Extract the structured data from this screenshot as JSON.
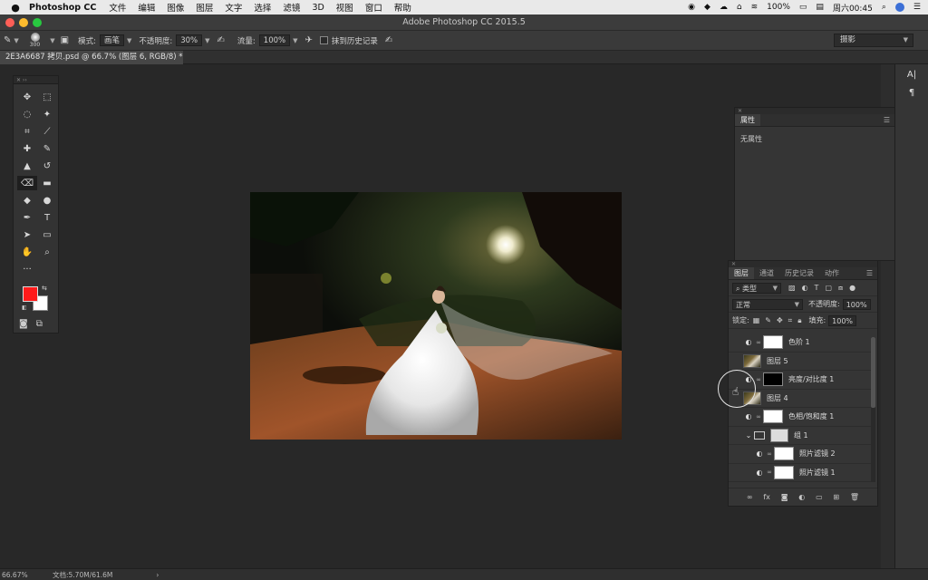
{
  "menubar": {
    "app_name": "Photoshop CC",
    "items": [
      "文件",
      "编辑",
      "图像",
      "图层",
      "文字",
      "选择",
      "滤镜",
      "3D",
      "视图",
      "窗口",
      "帮助"
    ],
    "battery": "100%",
    "clock": "周六00:45"
  },
  "window": {
    "title": "Adobe Photoshop CC 2015.5"
  },
  "options": {
    "brush_size": "300",
    "mode_label": "模式:",
    "mode_value": "画笔",
    "opacity_label": "不透明度:",
    "opacity_value": "30%",
    "flow_label": "流量:",
    "flow_value": "100%",
    "history_label": "抹到历史记录",
    "workspace": "摄影"
  },
  "document": {
    "tab_title": "2E3A6687 拷贝.psd @ 66.7% (图层 6, RGB/8) *"
  },
  "properties": {
    "tab": "属性",
    "empty_text": "无属性"
  },
  "layers_panel": {
    "tabs": [
      "图层",
      "通道",
      "历史记录",
      "动作"
    ],
    "filter_type": "类型",
    "blend_mode": "正常",
    "opacity_label": "不透明度:",
    "opacity_value": "100%",
    "lock_label": "锁定:",
    "fill_label": "填充:",
    "fill_value": "100%",
    "layers": [
      {
        "name": "色阶 1",
        "kind": "adjustment",
        "mask": "white"
      },
      {
        "name": "图层 5",
        "kind": "pixel"
      },
      {
        "name": "亮度/对比度 1",
        "kind": "adjustment",
        "mask": "black"
      },
      {
        "name": "图层 4",
        "kind": "pixel"
      },
      {
        "name": "色相/饱和度 1",
        "kind": "adjustment",
        "mask": "white"
      },
      {
        "name": "组 1",
        "kind": "group"
      },
      {
        "name": "照片滤镜 2",
        "kind": "adjustment",
        "mask": "white"
      },
      {
        "name": "照片滤镜 1",
        "kind": "adjustment",
        "mask": "white"
      }
    ]
  },
  "statusbar": {
    "zoom": "66.67%",
    "doc_size": "文档:5.70M/61.6M"
  },
  "colors": {
    "foreground": "#ff1a1a",
    "background": "#ffffff"
  },
  "icons": {
    "tools": [
      "move-tool-icon",
      "marquee-tool-icon",
      "lasso-tool-icon",
      "quick-select-icon",
      "crop-tool-icon",
      "eyedropper-icon",
      "healing-brush-icon",
      "brush-tool-icon",
      "clone-stamp-icon",
      "history-brush-icon",
      "eraser-tool-icon",
      "gradient-tool-icon",
      "blur-tool-icon",
      "dodge-tool-icon",
      "pen-tool-icon",
      "type-tool-icon",
      "path-select-icon",
      "rectangle-tool-icon",
      "hand-tool-icon",
      "zoom-tool-icon"
    ]
  }
}
